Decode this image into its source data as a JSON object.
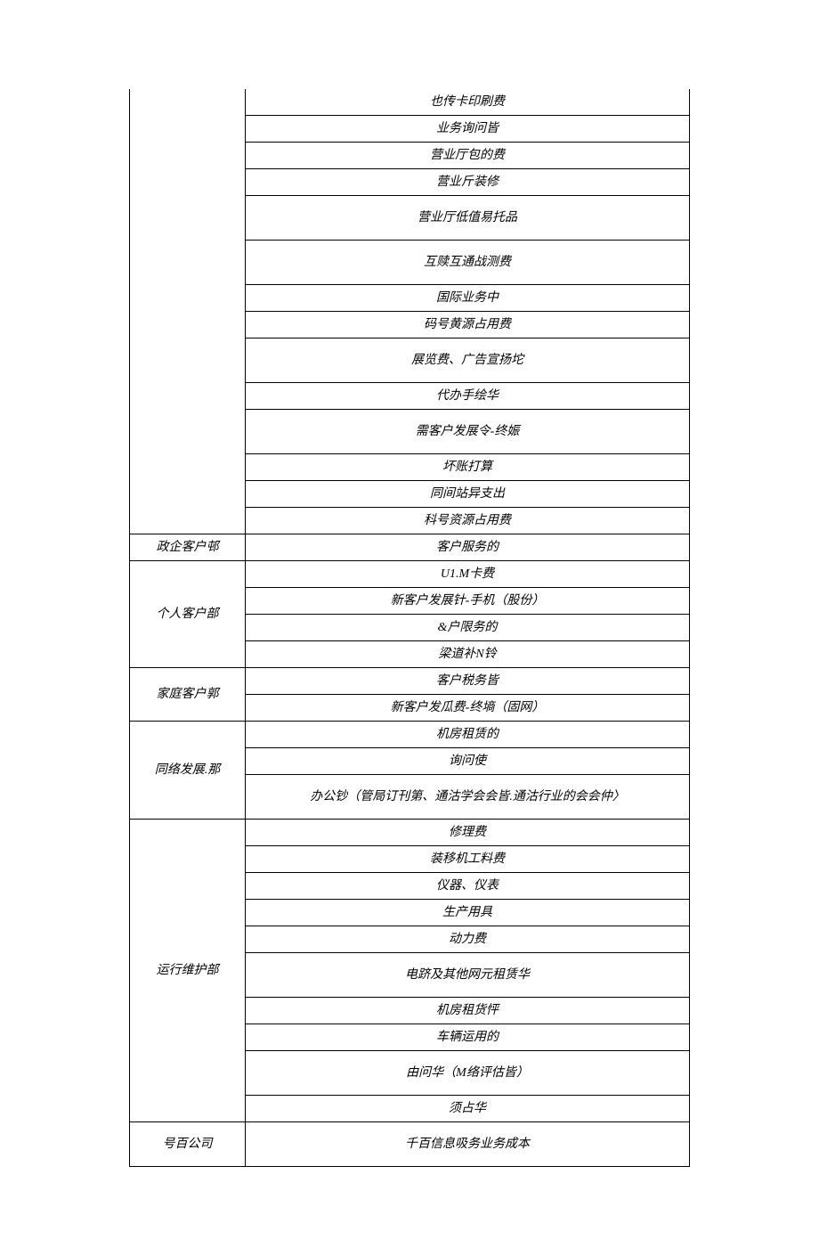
{
  "groups": [
    {
      "left": "",
      "rows": [
        "也传卡印刷费",
        "业务询问皆",
        "营业厅包的费",
        "营业斤装修",
        "营业厅低值易托品",
        "互赎互通战测费",
        "国际业务中",
        "码号黄源占用费",
        "展览费、广告宣扬坨",
        "代办手绘华",
        "需客户发展令-终娠",
        "坏账打算",
        "同间站异支出",
        "科号资源占用费"
      ]
    },
    {
      "left": "政企客户邨",
      "rows": [
        "客户服务的"
      ]
    },
    {
      "left": "个人客户部",
      "rows": [
        "U1.M卡费",
        "新客户发展针-手机（股份）",
        "&户限务的",
        "梁道补N铃"
      ]
    },
    {
      "left": "家庭客户郭",
      "rows": [
        "客户税务皆",
        "新客户发瓜费-终墒（固网）"
      ]
    },
    {
      "left": "同络发展.那",
      "rows": [
        "机房租赁的",
        "询问使",
        "办公钞（管局订刊第、通沽学会会皆.通沽行业的会会仲〉"
      ]
    },
    {
      "left": "运行维护部",
      "rows": [
        "修理费",
        "装移机工料费",
        "仪器、仪表",
        "生产用具",
        "动力费",
        "电跻及其他网元租赁华",
        "机房租货怦",
        "车辆运用的",
        "由问华（M络评估皆）",
        "须占华"
      ]
    },
    {
      "left": "号百公司",
      "rows": [
        "千百信息吸务业务成本"
      ]
    }
  ]
}
